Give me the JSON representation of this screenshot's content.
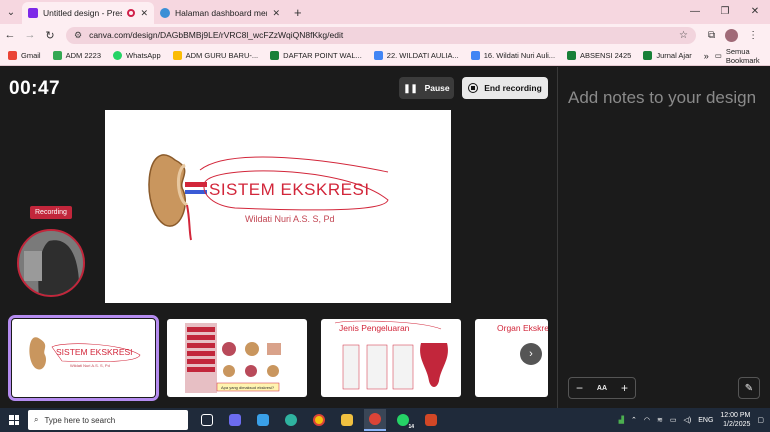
{
  "browser": {
    "tabs": [
      {
        "title": "Untitled design - Presentation",
        "favicon_color": "#7d2ae8",
        "active": true,
        "recording": true
      },
      {
        "title": "Halaman dashboard menulis",
        "favicon_color": "#3a8fd6",
        "active": false,
        "recording": false
      }
    ],
    "url": "canva.com/design/DAGbBMBj9LE/rVRC8l_wcFZzWqiQN8fKkg/edit",
    "bookmarks": [
      {
        "label": "Gmail",
        "color": "#ea4335"
      },
      {
        "label": "ADM 2223",
        "color": "#34a853"
      },
      {
        "label": "WhatsApp",
        "color": "#25d366"
      },
      {
        "label": "ADM GURU BARU-...",
        "color": "#fbbc04"
      },
      {
        "label": "DAFTAR POINT WAL...",
        "color": "#188038"
      },
      {
        "label": "22. WILDATI AULIA...",
        "color": "#4285f4"
      },
      {
        "label": "16. Wildati Nuri Auli...",
        "color": "#4285f4"
      },
      {
        "label": "ABSENSI 2425",
        "color": "#188038"
      },
      {
        "label": "Jurnal Ajar",
        "color": "#188038"
      }
    ],
    "bookmarks_all": "Semua Bookmark"
  },
  "presenter": {
    "timer": "00:47",
    "pause_label": "Pause",
    "end_label": "End recording",
    "recording_badge": "Recording",
    "slide": {
      "title": "SISTEM EKSKRESI",
      "subtitle": "Wildati Nuri A.S. S, Pd"
    },
    "thumbnails": [
      {
        "title": "SISTEM EKSKRESI",
        "subtitle": "Wildati Nuri A.S. S, Pd"
      },
      {
        "title": "",
        "caption": "Apa yang dimaksud ekskresi?"
      },
      {
        "title": "Jenis Pengeluaran"
      },
      {
        "title": "Organ Ekskre"
      }
    ]
  },
  "notes": {
    "placeholder": "Add notes to your design"
  },
  "taskbar": {
    "search_placeholder": "Type here to search",
    "whatsapp_badge": "14",
    "language": "ENG",
    "time": "12:00 PM",
    "date": "1/2/2025"
  }
}
